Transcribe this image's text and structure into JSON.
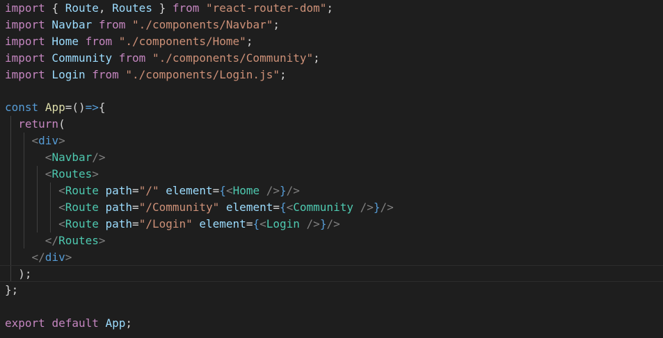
{
  "editor": {
    "theme_colors": {
      "background": "#1e1e1e",
      "keyword": "#569cd6",
      "control": "#c586c0",
      "variable": "#9cdcfe",
      "function": "#dcdcaa",
      "string": "#ce9178",
      "component_tag": "#4ec9b0",
      "angle_bracket": "#808080",
      "brace": "#ffd700",
      "punctuation": "#d4d4d4"
    },
    "lines": [
      {
        "tokens": [
          {
            "t": "import",
            "c": "ctrl"
          },
          {
            "t": " ",
            "c": "punct"
          },
          {
            "t": "{",
            "c": "punct"
          },
          {
            "t": " Route",
            "c": "var"
          },
          {
            "t": ",",
            "c": "punct"
          },
          {
            "t": " Routes",
            "c": "var"
          },
          {
            "t": " }",
            "c": "punct"
          },
          {
            "t": " from",
            "c": "ctrl"
          },
          {
            "t": " ",
            "c": "punct"
          },
          {
            "t": "\"react-router-dom\"",
            "c": "str"
          },
          {
            "t": ";",
            "c": "punct"
          }
        ]
      },
      {
        "tokens": [
          {
            "t": "import",
            "c": "ctrl"
          },
          {
            "t": " Navbar",
            "c": "var"
          },
          {
            "t": " from",
            "c": "ctrl"
          },
          {
            "t": " ",
            "c": "punct"
          },
          {
            "t": "\"./components/Navbar\"",
            "c": "str"
          },
          {
            "t": ";",
            "c": "punct"
          }
        ]
      },
      {
        "tokens": [
          {
            "t": "import",
            "c": "ctrl"
          },
          {
            "t": " Home",
            "c": "var"
          },
          {
            "t": " from",
            "c": "ctrl"
          },
          {
            "t": " ",
            "c": "punct"
          },
          {
            "t": "\"./components/Home\"",
            "c": "str"
          },
          {
            "t": ";",
            "c": "punct"
          }
        ]
      },
      {
        "tokens": [
          {
            "t": "import",
            "c": "ctrl"
          },
          {
            "t": " Community",
            "c": "var"
          },
          {
            "t": " from",
            "c": "ctrl"
          },
          {
            "t": " ",
            "c": "punct"
          },
          {
            "t": "\"./components/Community\"",
            "c": "str"
          },
          {
            "t": ";",
            "c": "punct"
          }
        ]
      },
      {
        "tokens": [
          {
            "t": "import",
            "c": "ctrl"
          },
          {
            "t": " Login",
            "c": "var"
          },
          {
            "t": " from",
            "c": "ctrl"
          },
          {
            "t": " ",
            "c": "punct"
          },
          {
            "t": "\"./components/Login.js\"",
            "c": "str"
          },
          {
            "t": ";",
            "c": "punct"
          }
        ]
      },
      {
        "tokens": []
      },
      {
        "tokens": [
          {
            "t": "const",
            "c": "kw"
          },
          {
            "t": " ",
            "c": "punct"
          },
          {
            "t": "App",
            "c": "fn"
          },
          {
            "t": "=",
            "c": "punct"
          },
          {
            "t": "()",
            "c": "punct"
          },
          {
            "t": "=>",
            "c": "kw"
          },
          {
            "t": "{",
            "c": "punct"
          }
        ]
      },
      {
        "tokens": [
          {
            "t": "  ",
            "c": "punct"
          },
          {
            "t": "return",
            "c": "ctrl"
          },
          {
            "t": "(",
            "c": "punct"
          }
        ]
      },
      {
        "tokens": [
          {
            "t": "    ",
            "c": "punct"
          },
          {
            "t": "<",
            "c": "bracket"
          },
          {
            "t": "div",
            "c": "kw"
          },
          {
            "t": ">",
            "c": "bracket"
          }
        ]
      },
      {
        "tokens": [
          {
            "t": "      ",
            "c": "punct"
          },
          {
            "t": "<",
            "c": "bracket"
          },
          {
            "t": "Navbar",
            "c": "tag"
          },
          {
            "t": "/>",
            "c": "bracket"
          }
        ]
      },
      {
        "tokens": [
          {
            "t": "      ",
            "c": "punct"
          },
          {
            "t": "<",
            "c": "bracket"
          },
          {
            "t": "Routes",
            "c": "tag"
          },
          {
            "t": ">",
            "c": "bracket"
          }
        ]
      },
      {
        "tokens": [
          {
            "t": "        ",
            "c": "punct"
          },
          {
            "t": "<",
            "c": "bracket"
          },
          {
            "t": "Route",
            "c": "tag"
          },
          {
            "t": " path",
            "c": "attr"
          },
          {
            "t": "=",
            "c": "punct"
          },
          {
            "t": "\"/\"",
            "c": "str"
          },
          {
            "t": " element",
            "c": "attr"
          },
          {
            "t": "=",
            "c": "punct"
          },
          {
            "t": "{",
            "c": "kw"
          },
          {
            "t": "<",
            "c": "bracket"
          },
          {
            "t": "Home",
            "c": "tag"
          },
          {
            "t": " />",
            "c": "bracket"
          },
          {
            "t": "}",
            "c": "kw"
          },
          {
            "t": "/>",
            "c": "bracket"
          }
        ]
      },
      {
        "tokens": [
          {
            "t": "        ",
            "c": "punct"
          },
          {
            "t": "<",
            "c": "bracket"
          },
          {
            "t": "Route",
            "c": "tag"
          },
          {
            "t": " path",
            "c": "attr"
          },
          {
            "t": "=",
            "c": "punct"
          },
          {
            "t": "\"/Community\"",
            "c": "str"
          },
          {
            "t": " element",
            "c": "attr"
          },
          {
            "t": "=",
            "c": "punct"
          },
          {
            "t": "{",
            "c": "kw"
          },
          {
            "t": "<",
            "c": "bracket"
          },
          {
            "t": "Community",
            "c": "tag"
          },
          {
            "t": " />",
            "c": "bracket"
          },
          {
            "t": "}",
            "c": "kw"
          },
          {
            "t": "/>",
            "c": "bracket"
          }
        ]
      },
      {
        "tokens": [
          {
            "t": "        ",
            "c": "punct"
          },
          {
            "t": "<",
            "c": "bracket"
          },
          {
            "t": "Route",
            "c": "tag"
          },
          {
            "t": " path",
            "c": "attr"
          },
          {
            "t": "=",
            "c": "punct"
          },
          {
            "t": "\"/Login\"",
            "c": "str"
          },
          {
            "t": " element",
            "c": "attr"
          },
          {
            "t": "=",
            "c": "punct"
          },
          {
            "t": "{",
            "c": "kw"
          },
          {
            "t": "<",
            "c": "bracket"
          },
          {
            "t": "Login",
            "c": "tag"
          },
          {
            "t": " />",
            "c": "bracket"
          },
          {
            "t": "}",
            "c": "kw"
          },
          {
            "t": "/>",
            "c": "bracket"
          }
        ]
      },
      {
        "tokens": [
          {
            "t": "      ",
            "c": "punct"
          },
          {
            "t": "</",
            "c": "bracket"
          },
          {
            "t": "Routes",
            "c": "tag"
          },
          {
            "t": ">",
            "c": "bracket"
          }
        ]
      },
      {
        "tokens": [
          {
            "t": "    ",
            "c": "punct"
          },
          {
            "t": "</",
            "c": "bracket"
          },
          {
            "t": "div",
            "c": "kw"
          },
          {
            "t": ">",
            "c": "bracket"
          }
        ]
      },
      {
        "tokens": [
          {
            "t": "  ",
            "c": "punct"
          },
          {
            "t": ");",
            "c": "punct"
          }
        ]
      },
      {
        "tokens": [
          {
            "t": "};",
            "c": "punct"
          }
        ]
      },
      {
        "tokens": []
      },
      {
        "tokens": [
          {
            "t": "export",
            "c": "ctrl"
          },
          {
            "t": " ",
            "c": "punct"
          },
          {
            "t": "default",
            "c": "ctrl"
          },
          {
            "t": " ",
            "c": "punct"
          },
          {
            "t": "App",
            "c": "var"
          },
          {
            "t": ";",
            "c": "punct"
          }
        ]
      }
    ],
    "current_line_index": 16
  }
}
